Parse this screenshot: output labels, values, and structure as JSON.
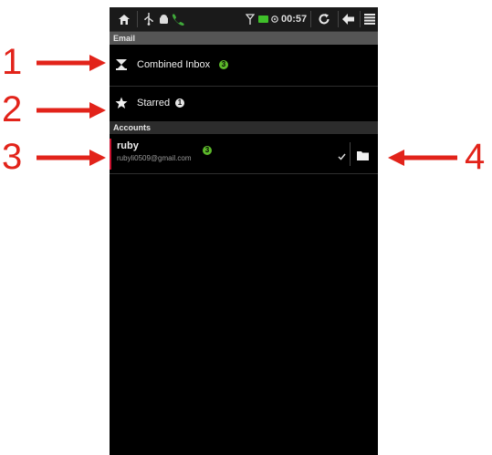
{
  "status_bar": {
    "time": "00:57",
    "icons": [
      "home-icon",
      "usb-icon",
      "android-debug-icon",
      "phone-icon",
      "wifi-icon",
      "battery-icon",
      "alarm-icon",
      "refresh-icon",
      "back-icon",
      "menu-icon"
    ]
  },
  "header": {
    "title": "Email"
  },
  "mailboxes": [
    {
      "label": "Combined Inbox",
      "badge": "3",
      "badge_color": "#5cb82a",
      "icon": "combined-inbox-icon"
    },
    {
      "label": "Starred",
      "badge": "1",
      "badge_color": "#e6e6e6",
      "icon": "star-icon"
    }
  ],
  "accounts_header": "Accounts",
  "account": {
    "name": "ruby",
    "email": "rubyli0509@gmail.com",
    "badge": "3",
    "badge_color": "#5cb82a"
  },
  "annotations": [
    "1",
    "2",
    "3",
    "4"
  ],
  "colors": {
    "annotation": "#e2231a",
    "accent_green": "#5cb82a",
    "account_bar": "#c8102e"
  }
}
